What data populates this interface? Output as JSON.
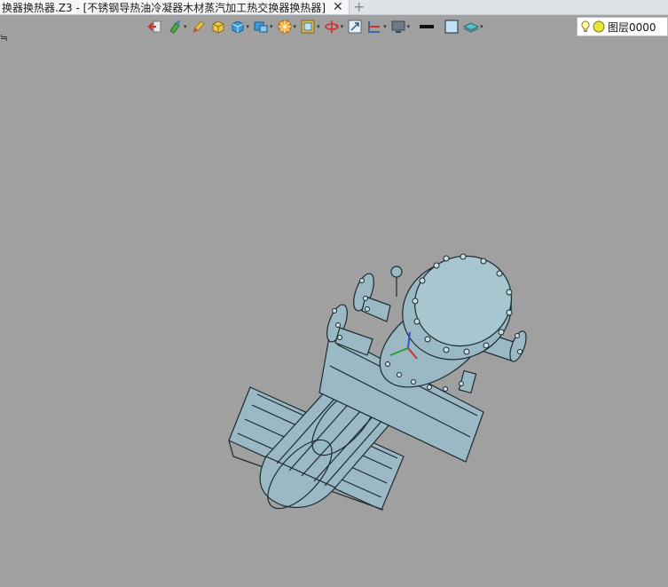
{
  "tab": {
    "title": "换器换热器.Z3 - [不锈钢导热油冷凝器木材蒸汽加工热交换器换热器]",
    "close_glyph": "✕",
    "add_glyph": "+"
  },
  "viewport": {
    "corner_mark": "≒"
  },
  "toolbar": {
    "items": [
      {
        "name": "exit-icon",
        "caret": false
      },
      {
        "name": "paint-icon",
        "caret": true
      },
      {
        "name": "pencil-icon",
        "caret": false
      },
      {
        "name": "box-yellow-icon",
        "caret": false
      },
      {
        "name": "cube-icon",
        "caret": true
      },
      {
        "name": "part-icon",
        "caret": true
      },
      {
        "name": "render-icon",
        "caret": true
      },
      {
        "name": "view-icon",
        "caret": true
      },
      {
        "name": "rotate-icon",
        "caret": true
      },
      {
        "name": "fit-icon",
        "caret": false
      },
      {
        "name": "section-icon",
        "caret": true
      },
      {
        "name": "display-icon",
        "caret": true
      },
      {
        "name": "line-weight-icon",
        "caret": false
      },
      {
        "name": "color-swatch-icon",
        "caret": false
      },
      {
        "name": "layer-stack-icon",
        "caret": true
      }
    ],
    "caret_glyph": "▾"
  },
  "layer": {
    "name": "图层0000"
  },
  "colors": {
    "model": "#9ab9c4",
    "edge": "#1d2a30",
    "background": "#a0a0a0"
  }
}
